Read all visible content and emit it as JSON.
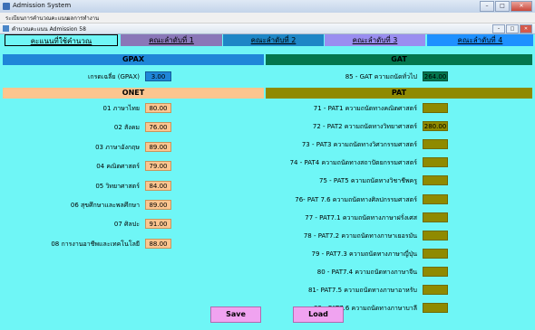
{
  "window": {
    "title": "Admission System"
  },
  "menu": [
    "ระเบียนการ",
    "คำนวณคะแนน",
    "ผลการทำงาน"
  ],
  "child": {
    "title": "คำนวณคะแนน Admission 58"
  },
  "tabs": [
    {
      "label": "คะแนนที่ใช้คำนวณ",
      "color": "#6ff6f6",
      "active": true
    },
    {
      "label": "คณะลำดับที่ 1",
      "color": "#8a77b8"
    },
    {
      "label": "คณะลำดับที่ 2",
      "color": "#1e86c6"
    },
    {
      "label": "คณะลำดับที่ 3",
      "color": "#9a8ef0"
    },
    {
      "label": "คณะลำดับที่ 4",
      "color": "#1e90ff"
    }
  ],
  "gpax": {
    "header": "GPAX",
    "label": "เกรดเฉลี่ย (GPAX)",
    "value": "3.00",
    "color": "#1f86d8"
  },
  "gat": {
    "header": "GAT",
    "label": "85 - GAT ความถนัดทั่วไป",
    "value": "264.00",
    "color": "#04764e"
  },
  "onet": {
    "header": "ONET",
    "color": "#fcc58f",
    "items": [
      {
        "label": "01 ภาษาไทย",
        "value": "80.00"
      },
      {
        "label": "02 สังคม",
        "value": "76.00"
      },
      {
        "label": "03 ภาษาอังกฤษ",
        "value": "89.00"
      },
      {
        "label": "04 คณิตศาสตร์",
        "value": "79.00"
      },
      {
        "label": "05 วิทยาศาสตร์",
        "value": "84.00"
      },
      {
        "label": "06 สุขศึกษาและพลศึกษา",
        "value": "89.00"
      },
      {
        "label": "07 ศิลปะ",
        "value": "91.00"
      },
      {
        "label": "08 การงานอาชีพและเทคโนโลยี",
        "value": "88.00"
      }
    ]
  },
  "pat": {
    "header": "PAT",
    "color": "#8f8a00",
    "items": [
      {
        "label": "71 - PAT1 ความถนัดทางคณิตศาสตร์",
        "value": ""
      },
      {
        "label": "72 - PAT2 ความถนัดทางวิทยาศาสตร์",
        "value": "280.00"
      },
      {
        "label": "73 - PAT3 ความถนัดทางวิศวกรรมศาสตร์",
        "value": ""
      },
      {
        "label": "74 - PAT4 ความถนัดทางสถาปัตยกรรมศาสตร์",
        "value": ""
      },
      {
        "label": "75 - PAT5 ความถนัดทางวิชาชีพครู",
        "value": ""
      },
      {
        "label": "76- PAT 7.6 ความถนัดทางศิลปกรรมศาสตร์",
        "value": ""
      },
      {
        "label": "77 - PAT7.1 ความถนัดทางภาษาฝรั่งเศส",
        "value": ""
      },
      {
        "label": "78 - PAT7.2 ความถนัดทางภาษาเยอรมัน",
        "value": ""
      },
      {
        "label": "79 - PAT7.3 ความถนัดทางภาษาญี่ปุ่น",
        "value": ""
      },
      {
        "label": "80 - PAT7.4 ความถนัดทางภาษาจีน",
        "value": ""
      },
      {
        "label": "81- PAT7.5 ความถนัดทางภาษาอาหรับ",
        "value": ""
      },
      {
        "label": "82 - PAT7.6 ความถนัดทางภาษาบาลี",
        "value": ""
      }
    ]
  },
  "buttons": {
    "save": "Save",
    "load": "Load"
  }
}
